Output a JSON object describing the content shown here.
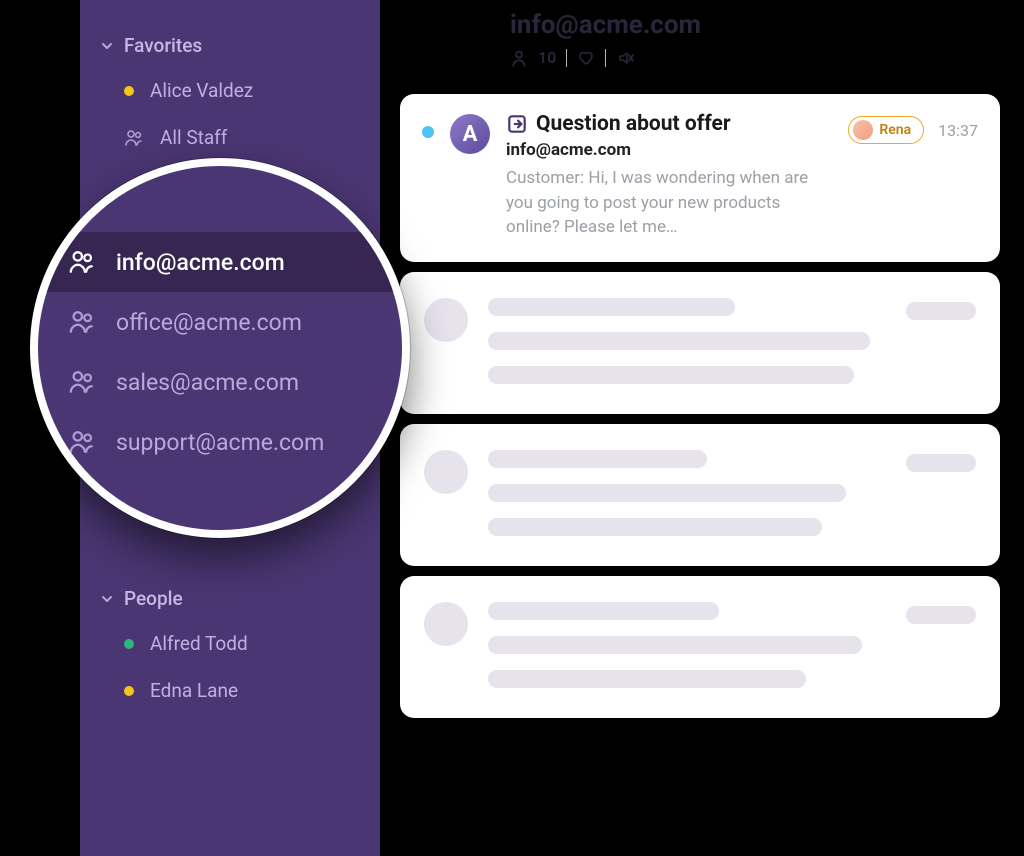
{
  "sidebar": {
    "favorites": {
      "title": "Favorites",
      "items": [
        {
          "label": "Alice Valdez",
          "status": "yellow"
        },
        {
          "label": "All Staff",
          "icon": "group"
        }
      ]
    },
    "inboxes": [
      {
        "label": "info@acme.com",
        "active": true
      },
      {
        "label": "office@acme.com",
        "active": false
      },
      {
        "label": "sales@acme.com",
        "active": false
      },
      {
        "label": "support@acme.com",
        "active": false
      }
    ],
    "people": {
      "title": "People",
      "items": [
        {
          "label": "Alfred Todd",
          "status": "green"
        },
        {
          "label": "Edna Lane",
          "status": "yellow"
        }
      ]
    }
  },
  "header": {
    "title": "info@acme.com",
    "member_count": "10"
  },
  "message": {
    "subject": "Question about offer",
    "from": "info@acme.com",
    "preview": "Customer: Hi, I was wondering when are you going to post your new products online? Please let me…",
    "tag_label": "Rena",
    "time": "13:37",
    "avatar_letter": "A"
  }
}
